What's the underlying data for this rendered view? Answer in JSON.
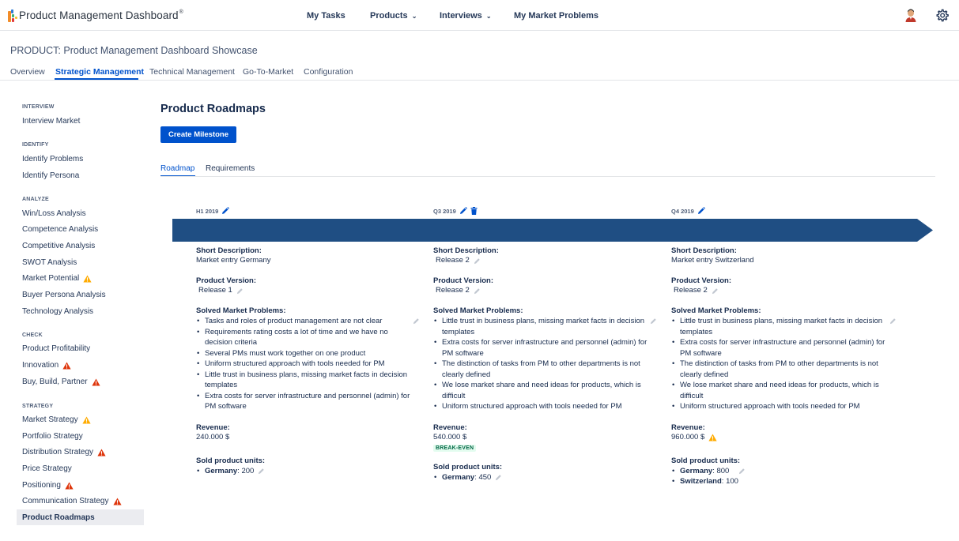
{
  "app": {
    "title": "Product Management Dashboard",
    "title_mark": "®"
  },
  "nav": {
    "items": [
      {
        "label": "My Tasks"
      },
      {
        "label": "Products",
        "caret": "⌄"
      },
      {
        "label": "Interviews",
        "caret": "⌄"
      },
      {
        "label": "My Market Problems"
      }
    ],
    "avatar_icon": "user-avatar-icon",
    "settings_icon": "gear-icon"
  },
  "product": {
    "title": "PRODUCT: Product Management Dashboard Showcase",
    "tabs": [
      {
        "label": "Overview"
      },
      {
        "label": "Strategic Management",
        "active": true
      },
      {
        "label": "Technical Management"
      },
      {
        "label": "Go-To-Market"
      },
      {
        "label": "Configuration"
      }
    ]
  },
  "sidebar": {
    "sections": [
      {
        "title": "INTERVIEW",
        "items": [
          {
            "label": "Interview Market"
          }
        ]
      },
      {
        "title": "IDENTIFY",
        "items": [
          {
            "label": "Identify Problems"
          },
          {
            "label": "Identify Persona"
          }
        ]
      },
      {
        "title": "ANALYZE",
        "items": [
          {
            "label": "Win/Loss Analysis"
          },
          {
            "label": "Competence Analysis"
          },
          {
            "label": "Competitive Analysis"
          },
          {
            "label": "SWOT Analysis"
          },
          {
            "label": "Market Potential",
            "status": "warning"
          },
          {
            "label": "Buyer Persona Analysis"
          },
          {
            "label": "Technology Analysis"
          }
        ]
      },
      {
        "title": "CHECK",
        "items": [
          {
            "label": "Product Profitability"
          },
          {
            "label": "Innovation",
            "status": "error"
          },
          {
            "label": "Buy, Build, Partner",
            "status": "error"
          }
        ]
      },
      {
        "title": "STRATEGY",
        "items": [
          {
            "label": "Market Strategy",
            "status": "warning"
          },
          {
            "label": "Portfolio Strategy"
          },
          {
            "label": "Distribution Strategy",
            "status": "error"
          },
          {
            "label": "Price Strategy"
          },
          {
            "label": "Positioning",
            "status": "error"
          },
          {
            "label": "Communication Strategy",
            "status": "error"
          },
          {
            "label": "Product Roadmaps",
            "active": true
          }
        ]
      }
    ],
    "colors": {
      "warning": "#ffab00",
      "error": "#de350b"
    }
  },
  "main": {
    "title": "Product Roadmaps",
    "create_button": "Create Milestone",
    "subtabs": [
      {
        "label": "Roadmap",
        "active": true
      },
      {
        "label": "Requirements"
      }
    ],
    "labels": {
      "short_description": "Short Description:",
      "product_version": "Product Version:",
      "solved_problems": "Solved Market Problems:",
      "revenue": "Revenue:",
      "sold_units": "Sold product units:"
    },
    "timeline_color": "#1f4e83",
    "milestones": [
      {
        "period": "H1 2019",
        "short_description": "Market entry Germany",
        "product_version": "Release 1",
        "problems": [
          "Tasks and roles of product management are not clear",
          "Requirements rating costs a lot of time and we have no decision criteria",
          "Several PMs must work together on one product",
          "Uniform structured approach with tools needed for PM",
          "Little trust in business plans, missing market facts in decision templates",
          "Extra costs for server infrastructure and personnel (admin) for PM software"
        ],
        "revenue": "240.000 $",
        "sold_units": [
          {
            "country": "Germany",
            "units": ": 200"
          }
        ]
      },
      {
        "period": "Q3 2019",
        "short_description": "Release 2",
        "product_version": "Release 2",
        "problems": [
          "Little trust in business plans, missing market facts in decision templates",
          "Extra costs for server infrastructure and personnel (admin) for PM software",
          "The distinction of tasks from PM to other departments is not clearly defined",
          "We lose market share and need ideas for products, which is difficult",
          "Uniform structured approach with tools needed for PM"
        ],
        "revenue": "540.000 $",
        "badge": "BREAK-EVEN",
        "sold_units": [
          {
            "country": "Germany",
            "units": ": 450"
          }
        ]
      },
      {
        "period": "Q4 2019",
        "short_description": "Market entry Switzerland",
        "product_version": "Release 2",
        "problems": [
          "Little trust in business plans, missing market facts in decision templates",
          "Extra costs for server infrastructure and personnel (admin) for PM software",
          "The distinction of tasks from PM to other departments is not clearly defined",
          "We lose market share and need ideas for products, which is difficult",
          "Uniform structured approach with tools needed for PM"
        ],
        "revenue": "960.000 $",
        "revenue_status": "warning",
        "sold_units": [
          {
            "country": "Germany",
            "units": ": 800"
          },
          {
            "country": "Switzerland",
            "units": ": 100"
          }
        ]
      }
    ]
  }
}
